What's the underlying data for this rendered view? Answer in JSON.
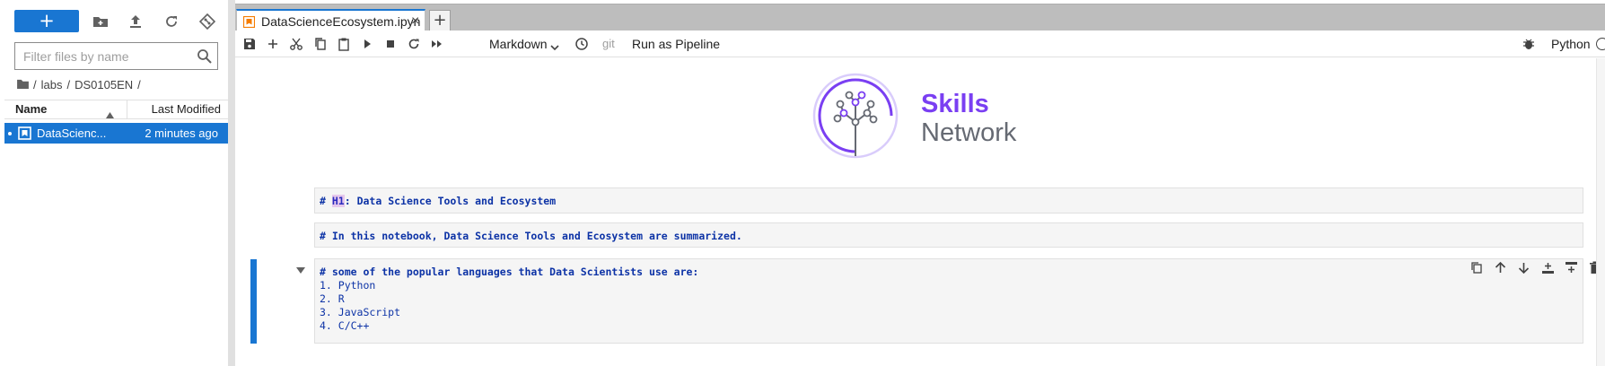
{
  "sidebar": {
    "new_button_label": "+",
    "toolbar_icons": [
      "new-folder-icon",
      "upload-icon",
      "refresh-icon",
      "git-clone-icon"
    ],
    "filter_placeholder": "Filter files by name",
    "breadcrumb": [
      "/",
      "labs",
      "/",
      "DS0105EN",
      "/"
    ],
    "columns": {
      "name": "Name",
      "modified": "Last Modified"
    },
    "files": [
      {
        "name": "DataScienc...",
        "modified": "2 minutes ago",
        "selected": true,
        "running": true
      }
    ]
  },
  "tabs": [
    {
      "label": "DataScienceEcosystem.ipyn",
      "close": "×",
      "active": true
    }
  ],
  "tab_add_label": "+",
  "notebook_toolbar": {
    "icons": [
      "save-icon",
      "add-cell-icon",
      "cut-icon",
      "copy-icon",
      "paste-icon",
      "run-icon",
      "stop-icon",
      "restart-icon",
      "run-all-icon",
      "history-icon"
    ],
    "cell_type": "Markdown",
    "git_label": "git",
    "run_pipeline_label": "Run as Pipeline",
    "kernel_name": "Python"
  },
  "logo": {
    "line1": "Skills",
    "line2": "Network",
    "primary_color": "#7a3ff2",
    "secondary_color": "#666a73"
  },
  "cells": {
    "h1": {
      "marker": "#",
      "h1_text": "H1",
      "rest": ": Data Science Tools and Ecosystem"
    },
    "intro": {
      "text": "# In this notebook, Data Science Tools and Ecosystem are summarized."
    },
    "langs": {
      "heading": "# some of the popular languages that Data Scientists use are:",
      "items": [
        "1. Python",
        "2. R",
        "3. JavaScript",
        "4. C/C++"
      ]
    }
  },
  "cell_toolbar_icons": [
    "duplicate-cell-icon",
    "move-up-icon",
    "move-down-icon",
    "insert-above-icon",
    "insert-below-icon",
    "delete-cell-icon"
  ],
  "colors": {
    "accent": "#1976d2",
    "markdown_text": "#0d33a6",
    "cell_bg": "#f5f5f5"
  }
}
